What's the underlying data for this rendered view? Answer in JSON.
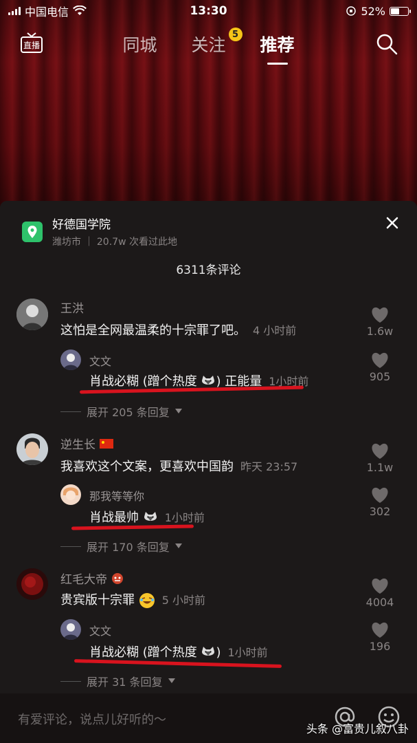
{
  "status_bar": {
    "carrier": "中国电信",
    "time": "13:30",
    "battery": "52%"
  },
  "top_nav": {
    "live_label": "直播",
    "tabs": [
      {
        "label": "同城"
      },
      {
        "label": "关注",
        "badge": "5"
      },
      {
        "label": "推荐"
      }
    ]
  },
  "location": {
    "title": "好德国学院",
    "subtitle": "潍坊市 ｜ 20.7w 次看过此地"
  },
  "comment_count": "6311条评论",
  "comments": [
    {
      "name": "王洪",
      "text": "这怕是全网最温柔的十宗罪了吧。",
      "time": "4 小时前",
      "likes": "1.6w",
      "reply": {
        "name": "文文",
        "text": "肖战必糊 (蹭个热度 ",
        "text_end": ") 正能量",
        "time": "1小时前",
        "likes": "905"
      },
      "expand": "展开 205 条回复"
    },
    {
      "name": "逆生长",
      "text": "我喜欢这个文案，更喜欢中国韵",
      "time": "昨天 23:57",
      "likes": "1.1w",
      "reply": {
        "name": "那我等等你",
        "text": "肖战最帅 ",
        "text_end": "",
        "time": "1小时前",
        "likes": "302"
      },
      "expand": "展开 170 条回复"
    },
    {
      "name": "红毛大帝",
      "text": "贵宾版十宗罪 ",
      "time": "5 小时前",
      "likes": "4004",
      "reply": {
        "name": "文文",
        "text": "肖战必糊 (蹭个热度 ",
        "text_end": ")",
        "time": "1小时前",
        "likes": "196"
      },
      "expand": "展开 31 条回复"
    }
  ],
  "input": {
    "placeholder": "有爱评论，说点儿好听的～"
  },
  "watermark": "头条 @富贵儿叙八卦",
  "colors": {
    "accent_badge": "#f5c518",
    "underline": "#d8131e",
    "location_icon": "#2ec26b"
  }
}
